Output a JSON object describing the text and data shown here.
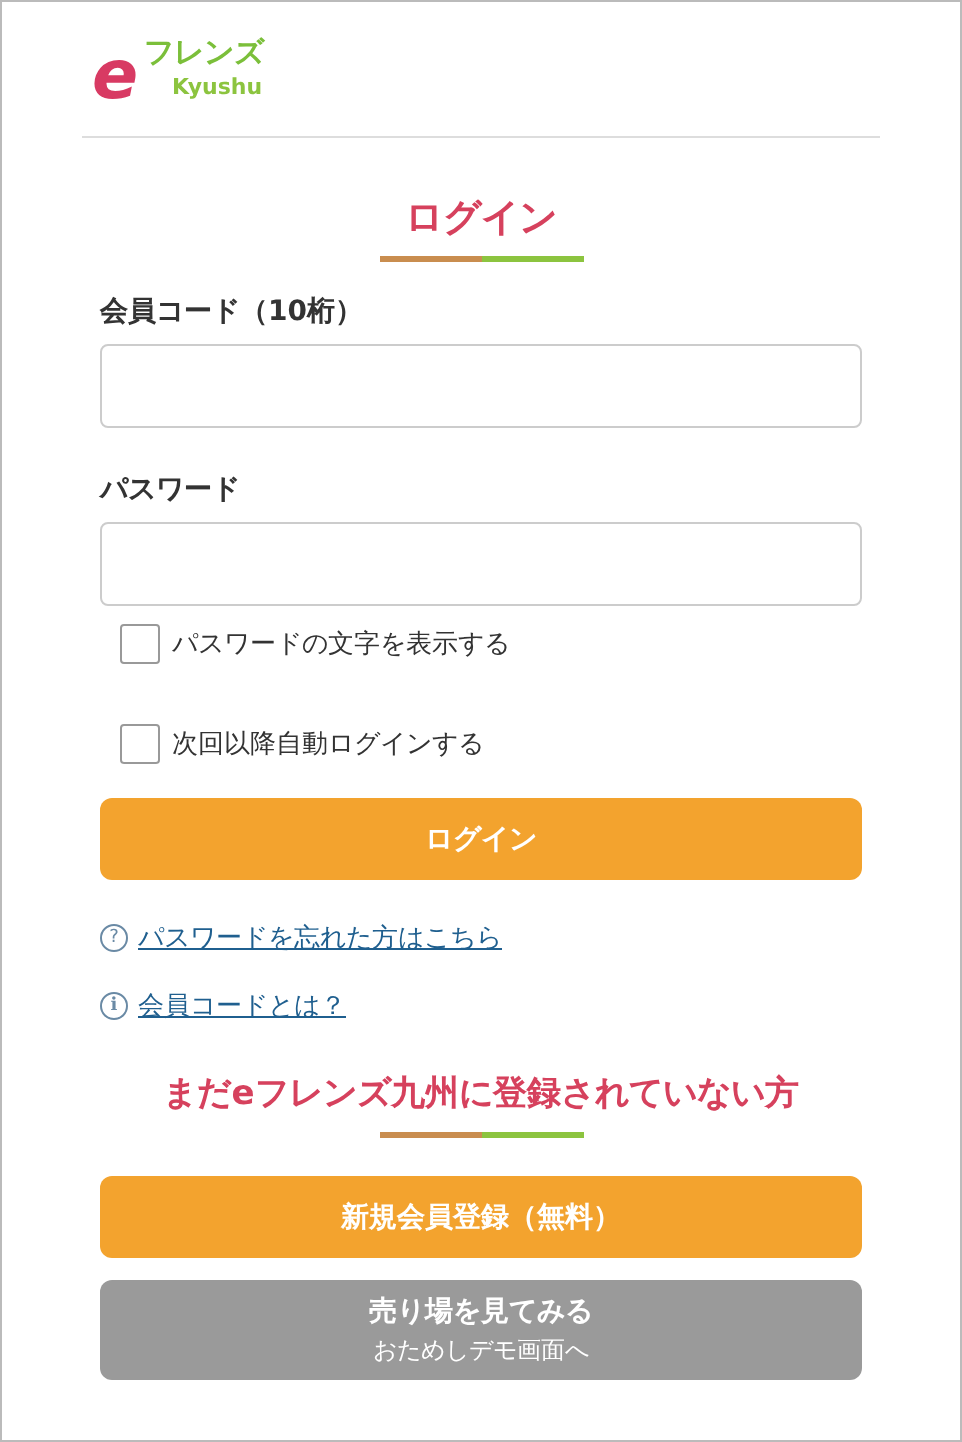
{
  "logo": {
    "mark": "e",
    "name": "フレンズ",
    "sub": "Kyushu"
  },
  "login_title": "ログイン",
  "fields": [
    {
      "label": "会員コード（10桁）"
    },
    {
      "label": "パスワード"
    }
  ],
  "checkboxes": [
    {
      "label": "パスワードの文字を表示する",
      "checked": false
    },
    {
      "label": "次回以降自動ログインする",
      "checked": false
    }
  ],
  "login_button": "ログイン",
  "links": [
    {
      "kind": "help",
      "icon": "?",
      "text": "パスワードを忘れた方はこちら"
    },
    {
      "kind": "info",
      "icon": "i",
      "text": "会員コードとは？"
    }
  ],
  "register_title": "まだeフレンズ九州に登録されていない方",
  "register_button": "新規会員登録（無料）",
  "demo_button": {
    "title": "売り場を見てみる",
    "subtitle": "おためしデモ画面へ"
  }
}
